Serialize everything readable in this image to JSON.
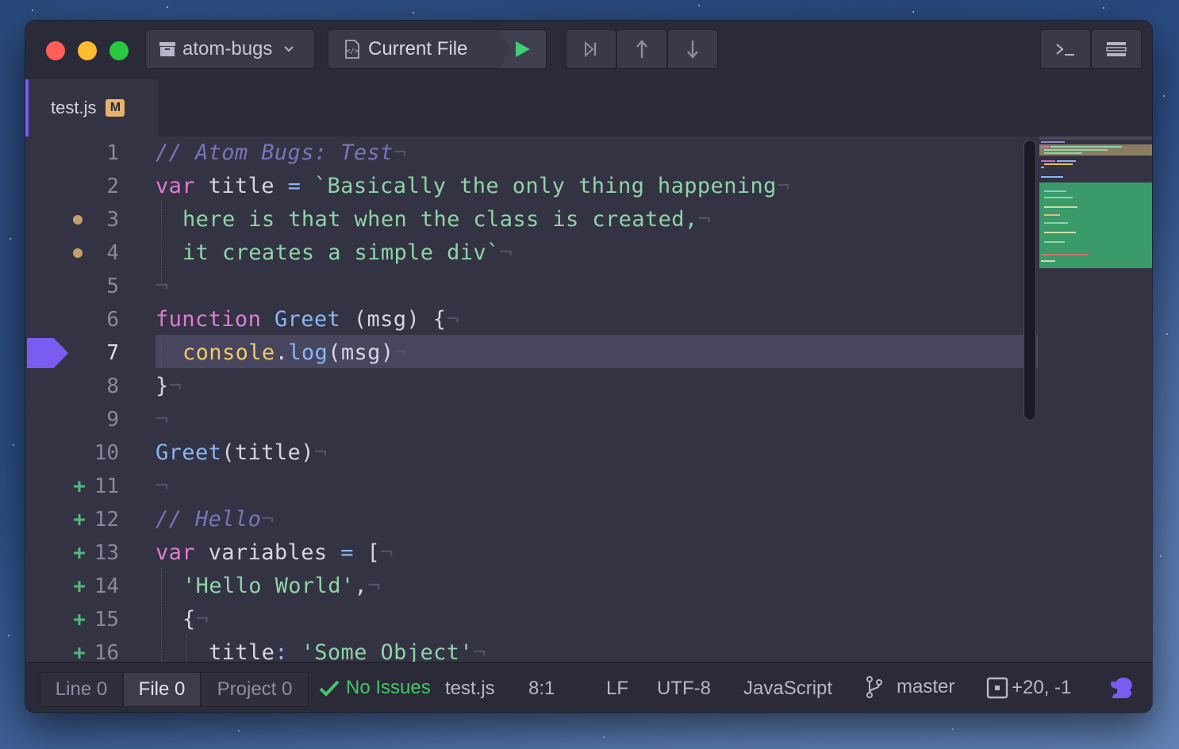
{
  "toolbar": {
    "project_label": "atom-bugs",
    "current_file_label": "Current File"
  },
  "tab": {
    "title": "test.js",
    "badge": "M"
  },
  "editor": {
    "current_line": 7,
    "lines": [
      {
        "num": "1",
        "mark": ""
      },
      {
        "num": "2",
        "mark": ""
      },
      {
        "num": "3",
        "mark": "dot"
      },
      {
        "num": "4",
        "mark": "dot"
      },
      {
        "num": "5",
        "mark": ""
      },
      {
        "num": "6",
        "mark": ""
      },
      {
        "num": "7",
        "mark": "breakpoint"
      },
      {
        "num": "8",
        "mark": ""
      },
      {
        "num": "9",
        "mark": ""
      },
      {
        "num": "10",
        "mark": ""
      },
      {
        "num": "11",
        "mark": "+"
      },
      {
        "num": "12",
        "mark": "+"
      },
      {
        "num": "13",
        "mark": "+"
      },
      {
        "num": "14",
        "mark": "+"
      },
      {
        "num": "15",
        "mark": "+"
      },
      {
        "num": "16",
        "mark": "+"
      }
    ],
    "code": {
      "l1_comment": "// Atom Bugs: Test",
      "l2_var": "var",
      "l2_name": " title ",
      "l2_eq": "=",
      "l2_str": " `Basically the only thing happening",
      "l3_str": "here is that when the class is created,",
      "l4_str": "it creates a simple div`",
      "l6_function": "function",
      "l6_name": " Greet",
      "l6_params": " (msg) {",
      "l7_console": "console",
      "l7_dot": ".",
      "l7_log": "log",
      "l7_args": "(msg)",
      "l8_close": "}",
      "l10_greet": "Greet",
      "l10_args": "(title)",
      "l12_comment": "// Hello",
      "l13_var": "var",
      "l13_name": " variables ",
      "l13_eq": "=",
      "l13_open": " [",
      "l14_str": "'Hello World'",
      "l14_comma": ",",
      "l15_brace": "{",
      "l16_key": "title",
      "l16_colon": ":",
      "l16_str": " 'Some Object'",
      "eol": "¬"
    }
  },
  "status": {
    "line_tab": "Line 0",
    "file_tab": "File 0",
    "project_tab": "Project 0",
    "no_issues": "No Issues",
    "filename": "test.js",
    "cursor": "8:1",
    "line_ending": "LF",
    "encoding": "UTF-8",
    "grammar": "JavaScript",
    "branch": "master",
    "diff": "+20, -1"
  },
  "colors": {
    "accent": "#7b5cf0",
    "added": "#4fb87a",
    "modified": "#c2a06a",
    "no_issues": "#45c46b"
  }
}
